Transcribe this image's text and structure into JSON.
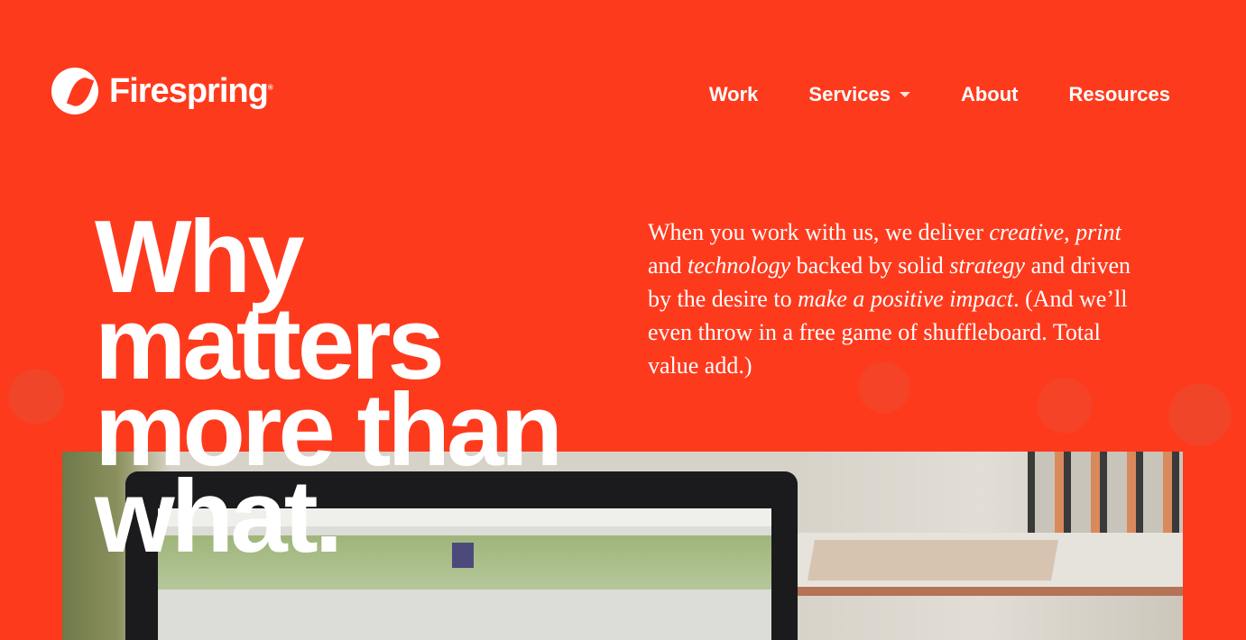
{
  "brand": {
    "name": "Firespring",
    "mark": "®",
    "color": "#fe3a1d"
  },
  "nav": [
    {
      "label": "Work"
    },
    {
      "label": "Services",
      "has_dropdown": true
    },
    {
      "label": "About"
    },
    {
      "label": "Resources"
    }
  ],
  "hero": {
    "headline": [
      "Why",
      "matters",
      "more than",
      "what."
    ],
    "intro": {
      "p1": "When you work with us, we deliver ",
      "i1": "creative",
      "p2": ", ",
      "i2": "print",
      "p3": " and ",
      "i3": "technology",
      "p4": " backed by solid ",
      "i4": "strategy",
      "p5": " and driven by the desire to ",
      "i5": "make a positive impact",
      "p6": ". (And we’ll even throw in a free game of shuffleboard. Total value add.)"
    }
  }
}
